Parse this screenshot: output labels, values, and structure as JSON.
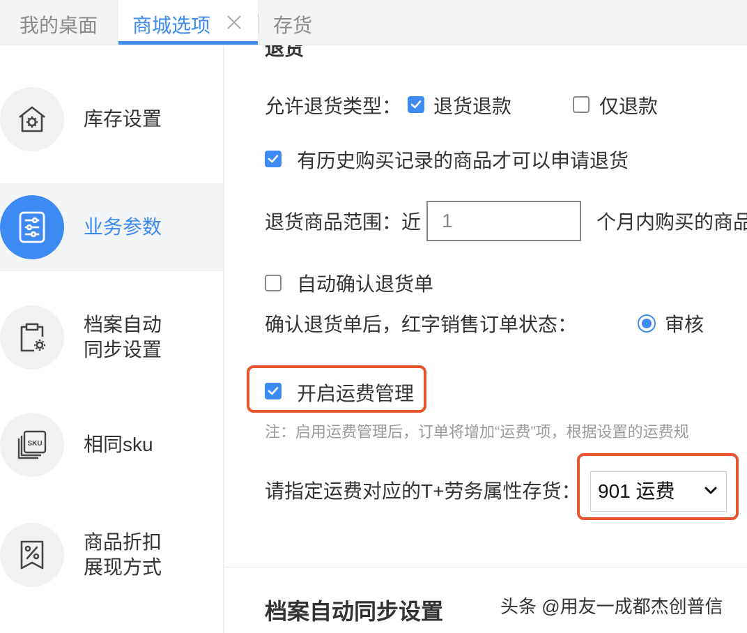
{
  "tabs": [
    {
      "label": "我的桌面",
      "active": false
    },
    {
      "label": "商城选项",
      "active": true
    },
    {
      "label": "存货",
      "active": false
    }
  ],
  "sidebar": {
    "items": [
      {
        "label": "库存设置",
        "icon": "warehouse-gear-icon",
        "active": false
      },
      {
        "label": "业务参数",
        "icon": "sliders-document-icon",
        "active": true
      },
      {
        "label": "档案自动\n同步设置",
        "icon": "clipboard-gear-icon",
        "active": false
      },
      {
        "label": "相同sku",
        "icon": "sku-stack-icon",
        "active": false
      },
      {
        "label": "商品折扣\n展现方式",
        "icon": "discount-tag-icon",
        "active": false
      }
    ]
  },
  "returns": {
    "section_title": "退货",
    "allow_types_label": "允许退货类型：",
    "option_return_refund": {
      "label": "退货退款",
      "checked": true
    },
    "option_refund_only": {
      "label": "仅退款",
      "checked": false
    },
    "history_purchase": {
      "label": "有历史购买记录的商品才可以申请退货",
      "checked": true
    },
    "range_label": "退货商品范围：近",
    "range_value": "1",
    "range_suffix": "个月内购买的商品",
    "auto_confirm": {
      "label": "自动确认退货单",
      "checked": false
    },
    "after_confirm_label": "确认退货单后，红字销售订单状态：",
    "after_confirm_option": {
      "label": "审核",
      "selected": true
    }
  },
  "freight": {
    "enable": {
      "label": "开启运费管理",
      "checked": true
    },
    "note": "注：启用运费管理后，订单将增加“运费”项，根据设置的运费规",
    "specify_label": "请指定运费对应的T+劳务属性存货：",
    "selected_value": "901 运费"
  },
  "next_section_title": "档案自动同步设置",
  "watermark": "头条 @用友一成都杰创普信",
  "colors": {
    "accent": "#3d8bf2",
    "highlight": "#e6552c"
  }
}
